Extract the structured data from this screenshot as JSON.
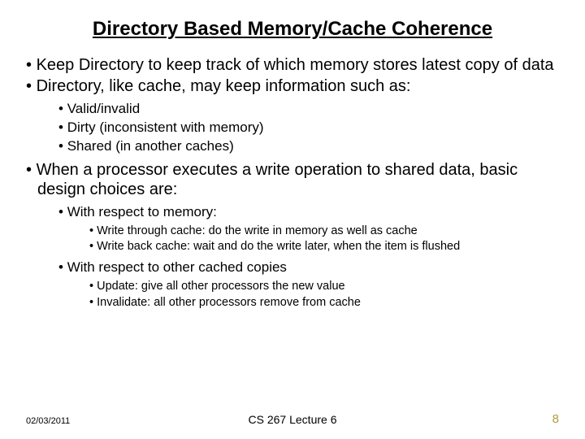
{
  "title": "Directory Based Memory/Cache Coherence",
  "bullets": {
    "b1": "Keep Directory to keep track of which memory stores latest copy of data",
    "b2": "Directory, like cache, may keep information such as:",
    "b2_1": "Valid/invalid",
    "b2_2": "Dirty (inconsistent with memory)",
    "b2_3": "Shared (in another caches)",
    "b3": "When a processor executes a write operation to shared data, basic design choices are:",
    "b3_1": "With respect to memory:",
    "b3_1_1": "Write through cache: do the write in memory as well as cache",
    "b3_1_2": "Write back cache: wait and do the write later, when the item is flushed",
    "b3_2": "With respect to other cached copies",
    "b3_2_1": "Update: give all other processors the new value",
    "b3_2_2": "Invalidate: all other processors remove from cache"
  },
  "footer": {
    "date": "02/03/2011",
    "center": "CS 267 Lecture 6",
    "page": "8"
  }
}
